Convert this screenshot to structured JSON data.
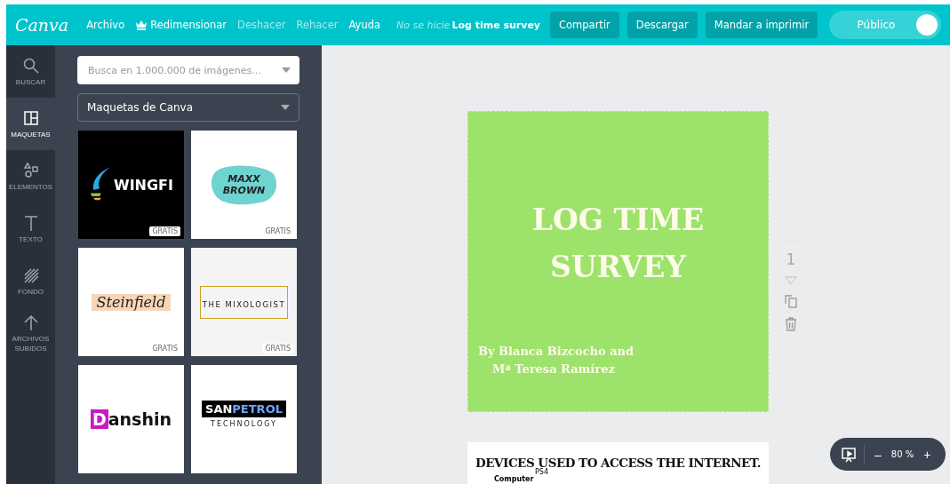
{
  "topbar": {
    "logo": "Canva",
    "menu": [
      {
        "label": "Archivo",
        "disabled": false,
        "kind": "text"
      },
      {
        "label": "Redimensionar",
        "disabled": false,
        "kind": "crown"
      },
      {
        "label": "Deshacer",
        "disabled": true,
        "kind": "text"
      },
      {
        "label": "Rehacer",
        "disabled": true,
        "kind": "text"
      },
      {
        "label": "Ayuda",
        "disabled": false,
        "kind": "text"
      }
    ],
    "status": "No se hicie",
    "title": "Log time survey",
    "buttons": [
      "Compartir",
      "Descargar",
      "Mandar a imprimir"
    ],
    "public_toggle": {
      "label": "Público",
      "on": true
    }
  },
  "sidebar": {
    "items": [
      {
        "label": "BUSCAR",
        "kind": "search",
        "selected": false
      },
      {
        "label": "MAQUETAS",
        "kind": "layouts",
        "selected": true
      },
      {
        "label": "ELEMENTOS",
        "kind": "elements",
        "selected": false
      },
      {
        "label": "TEXTO",
        "kind": "text",
        "selected": false
      },
      {
        "label": "FONDO",
        "kind": "background",
        "selected": false
      },
      {
        "label": "ARCHIVOS SUBIDOS",
        "kind": "upload",
        "selected": false
      }
    ]
  },
  "panel": {
    "search": {
      "placeholder": "Busca en 1.000.000 de imágenes..."
    },
    "category": "Maquetas de Canva",
    "templates": [
      {
        "kind": "wingfi",
        "texts": [
          "WINGFI"
        ],
        "badge": "GRATIS"
      },
      {
        "kind": "maxx",
        "texts": [
          "MAXX",
          "BROWN"
        ],
        "badge": "GRATIS"
      },
      {
        "kind": "steinfield",
        "texts": [
          "Steinfield"
        ],
        "badge": "GRATIS"
      },
      {
        "kind": "mixologist",
        "texts": [
          "THE MIXOLOGIST"
        ],
        "badge": "GRATIS"
      },
      {
        "kind": "danshin",
        "texts": [
          "D",
          "anshin"
        ]
      },
      {
        "kind": "sanpetrol",
        "texts": [
          "SAN",
          "PETROL",
          "TECHNOLOGY"
        ]
      }
    ]
  },
  "pages": [
    {
      "title": "LOG TIME SURVEY",
      "byline": "By Blanca Bizcocho and",
      "byline_2": "Mª Teresa Ramírez"
    },
    {
      "title": "DEVICES USED TO ACCESS THE INTERNET.",
      "labels": [
        "PS4",
        "Computer"
      ]
    }
  ],
  "page_tools": {
    "number": "1"
  },
  "zoom": {
    "value": "80 %",
    "minus": "–",
    "plus": "+"
  }
}
